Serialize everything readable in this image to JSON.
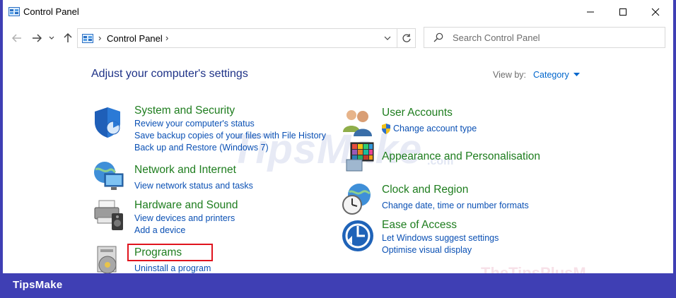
{
  "window": {
    "title": "Control Panel",
    "controls": {
      "minimize_icon": "minimize-icon",
      "maximize_icon": "maximize-icon",
      "close_icon": "close-icon"
    }
  },
  "nav": {
    "back_icon": "arrow-left-icon",
    "forward_icon": "arrow-right-icon",
    "recent_icon": "chevron-down-icon",
    "up_icon": "arrow-up-icon"
  },
  "address": {
    "separator": "›",
    "path": "Control Panel",
    "trailing_separator": "›",
    "dropdown_icon": "chevron-down-icon",
    "refresh_icon": "refresh-icon"
  },
  "search": {
    "placeholder": "Search Control Panel",
    "icon": "search-icon"
  },
  "main": {
    "heading": "Adjust your computer's settings",
    "view_by_label": "View by:",
    "view_by_value": "Category"
  },
  "categories_left": [
    {
      "title": "System and Security",
      "icon": "shield-icon",
      "links": [
        "Review your computer's status",
        "Save backup copies of your files with File History",
        "Back up and Restore (Windows 7)"
      ]
    },
    {
      "title": "Network and Internet",
      "icon": "network-globe-icon",
      "links": [
        "View network status and tasks"
      ]
    },
    {
      "title": "Hardware and Sound",
      "icon": "printer-speaker-icon",
      "links": [
        "View devices and printers",
        "Add a device"
      ]
    },
    {
      "title": "Programs",
      "icon": "programs-disc-icon",
      "links": [
        "Uninstall a program"
      ]
    }
  ],
  "categories_right": [
    {
      "title": "User Accounts",
      "icon": "users-icon",
      "links": [
        "Change account type"
      ]
    },
    {
      "title": "Appearance and Personalisation",
      "icon": "appearance-icon",
      "links": []
    },
    {
      "title": "Clock and Region",
      "icon": "clock-globe-icon",
      "links": [
        "Change date, time or number formats"
      ]
    },
    {
      "title": "Ease of Access",
      "icon": "ease-of-access-icon",
      "links": [
        "Let Windows suggest settings",
        "Optimise visual display"
      ]
    }
  ],
  "watermark": {
    "text": "TipsMake",
    "domain": ".com",
    "secondary": "TheTipsPlusM"
  },
  "footer": {
    "brand": "TipsMake"
  },
  "colors": {
    "accent_link": "#0a50b4",
    "category_title": "#1e7d1e",
    "heading": "#1e3287",
    "brand_bar": "#3f3fb4",
    "highlight": "#e0141e"
  }
}
